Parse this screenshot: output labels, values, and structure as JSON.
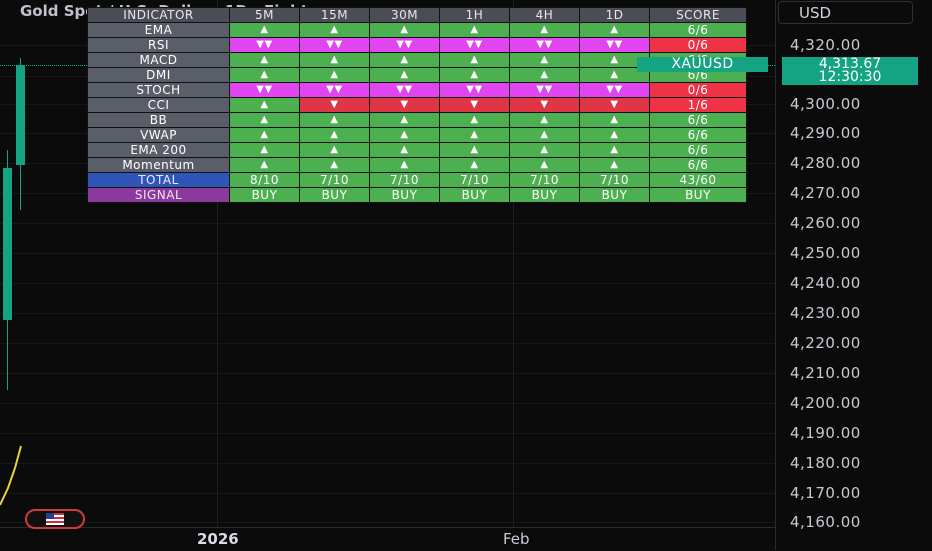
{
  "chart": {
    "title_text": "Gold Spot / U.S. Dollar · 1D · Fightemp",
    "currency": "USD",
    "price_ticks": [
      "4,320.00",
      "4,310.00",
      "4,300.00",
      "4,290.00",
      "4,280.00",
      "4,270.00",
      "4,260.00",
      "4,250.00",
      "4,240.00",
      "4,230.00",
      "4,220.00",
      "4,210.00",
      "4,200.00",
      "4,190.00",
      "4,180.00",
      "4,170.00",
      "4,160.00"
    ],
    "last_price": {
      "symbol": "XAUUSD",
      "price": "4,313.67",
      "countdown": "12:30:30"
    },
    "time_labels": [
      "2026",
      "Feb"
    ],
    "colors": {
      "up": "#14a383",
      "ma": "#e6d33a"
    }
  },
  "table": {
    "headers": [
      "INDICATOR",
      "5M",
      "15M",
      "30M",
      "1H",
      "4H",
      "1D",
      "SCORE"
    ],
    "rows": [
      {
        "name": "EMA",
        "cells": [
          "▲",
          "▲",
          "▲",
          "▲",
          "▲",
          "▲"
        ],
        "styles": [
          "up",
          "up",
          "up",
          "up",
          "up",
          "up"
        ],
        "score": "6/6",
        "score_style": "score-g"
      },
      {
        "name": "RSI",
        "cells": [
          "▼▼",
          "▼▼",
          "▼▼",
          "▼▼",
          "▼▼",
          "▼▼"
        ],
        "styles": [
          "down",
          "down",
          "down",
          "down",
          "down",
          "down"
        ],
        "score": "0/6",
        "score_style": "score-r"
      },
      {
        "name": "MACD",
        "cells": [
          "▲",
          "▲",
          "▲",
          "▲",
          "▲",
          "▲"
        ],
        "styles": [
          "up",
          "up",
          "up",
          "up",
          "up",
          "up"
        ],
        "score": "6/6",
        "score_style": "score-g"
      },
      {
        "name": "DMI",
        "cells": [
          "▲",
          "▲",
          "▲",
          "▲",
          "▲",
          "▲"
        ],
        "styles": [
          "up",
          "up",
          "up",
          "up",
          "up",
          "up"
        ],
        "score": "6/6",
        "score_style": "score-g"
      },
      {
        "name": "STOCH",
        "cells": [
          "▼▼",
          "▼▼",
          "▼▼",
          "▼▼",
          "▼▼",
          "▼▼"
        ],
        "styles": [
          "down",
          "down",
          "down",
          "down",
          "down",
          "down"
        ],
        "score": "0/6",
        "score_style": "score-r"
      },
      {
        "name": "CCI",
        "cells": [
          "▲",
          "▼",
          "▼",
          "▼",
          "▼",
          "▼"
        ],
        "styles": [
          "up",
          "down-red",
          "down-red",
          "down-red",
          "down-red",
          "down-red"
        ],
        "score": "1/6",
        "score_style": "score-r"
      },
      {
        "name": "BB",
        "cells": [
          "▲",
          "▲",
          "▲",
          "▲",
          "▲",
          "▲"
        ],
        "styles": [
          "up",
          "up",
          "up",
          "up",
          "up",
          "up"
        ],
        "score": "6/6",
        "score_style": "score-g"
      },
      {
        "name": "VWAP",
        "cells": [
          "▲",
          "▲",
          "▲",
          "▲",
          "▲",
          "▲"
        ],
        "styles": [
          "up",
          "up",
          "up",
          "up",
          "up",
          "up"
        ],
        "score": "6/6",
        "score_style": "score-g"
      },
      {
        "name": "EMA 200",
        "cells": [
          "▲",
          "▲",
          "▲",
          "▲",
          "▲",
          "▲"
        ],
        "styles": [
          "up",
          "up",
          "up",
          "up",
          "up",
          "up"
        ],
        "score": "6/6",
        "score_style": "score-g"
      },
      {
        "name": "Momentum",
        "cells": [
          "▲",
          "▲",
          "▲",
          "▲",
          "▲",
          "▲"
        ],
        "styles": [
          "up",
          "up",
          "up",
          "up",
          "up",
          "up"
        ],
        "score": "6/6",
        "score_style": "score-g"
      }
    ],
    "total": {
      "name": "TOTAL",
      "cells": [
        "8/10",
        "7/10",
        "7/10",
        "7/10",
        "7/10",
        "7/10"
      ],
      "score": "43/60"
    },
    "signal": {
      "name": "SIGNAL",
      "cells": [
        "BUY",
        "BUY",
        "BUY",
        "BUY",
        "BUY",
        "BUY"
      ],
      "score": "BUY"
    }
  }
}
